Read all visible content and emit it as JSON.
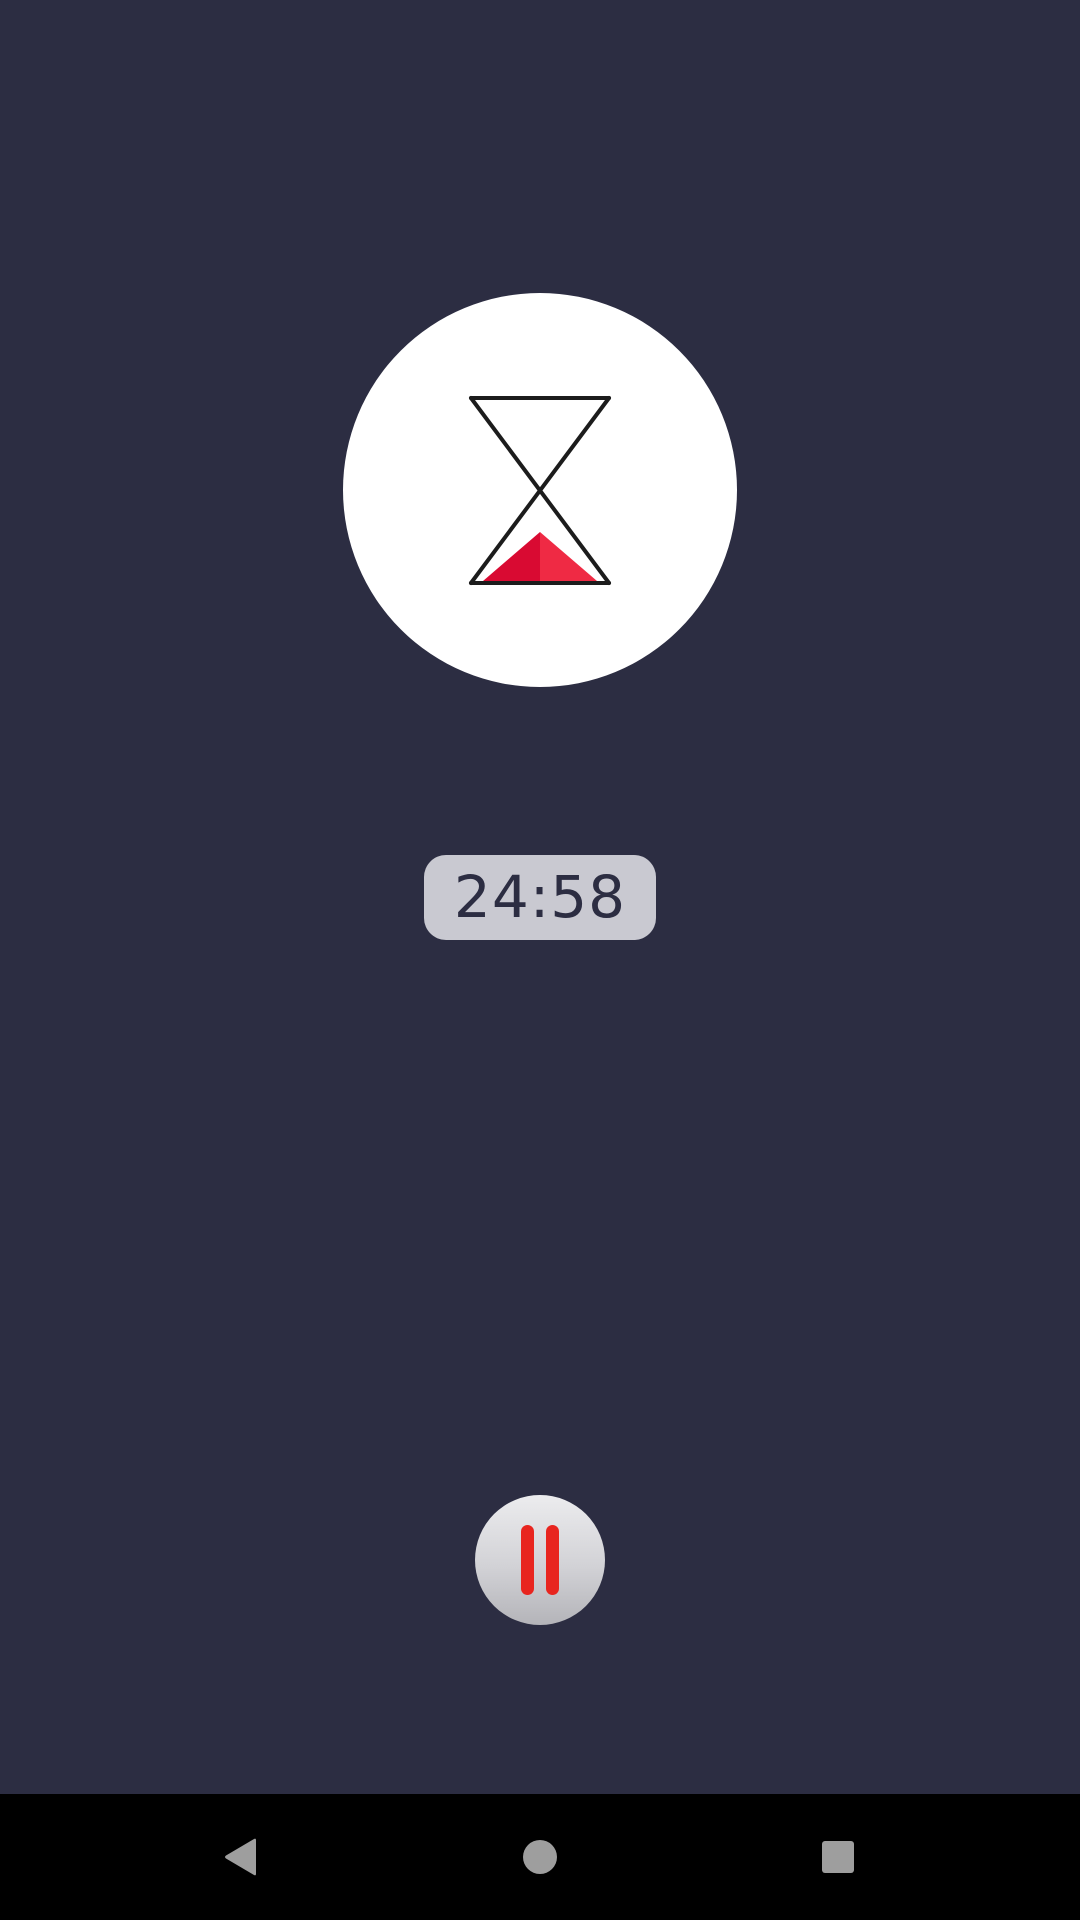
{
  "colors": {
    "background": "#2c2d42",
    "badge": "#ffffff",
    "sand_dark": "#d90a32",
    "sand_light": "#ef2a44",
    "glass_outline": "#1c1c1c",
    "pill_background": "#c9c9d1",
    "pill_text": "#2c2d42",
    "pause_bars": "#e8251f",
    "nav_bar": "#000000",
    "nav_icons": "#9e9e9e"
  },
  "timer": {
    "remaining": "24:58",
    "status_icon": "hourglass-icon",
    "control_icon": "pause-icon"
  },
  "navigation": {
    "back_icon": "back-triangle-icon",
    "home_icon": "home-circle-icon",
    "recents_icon": "recents-square-icon"
  }
}
